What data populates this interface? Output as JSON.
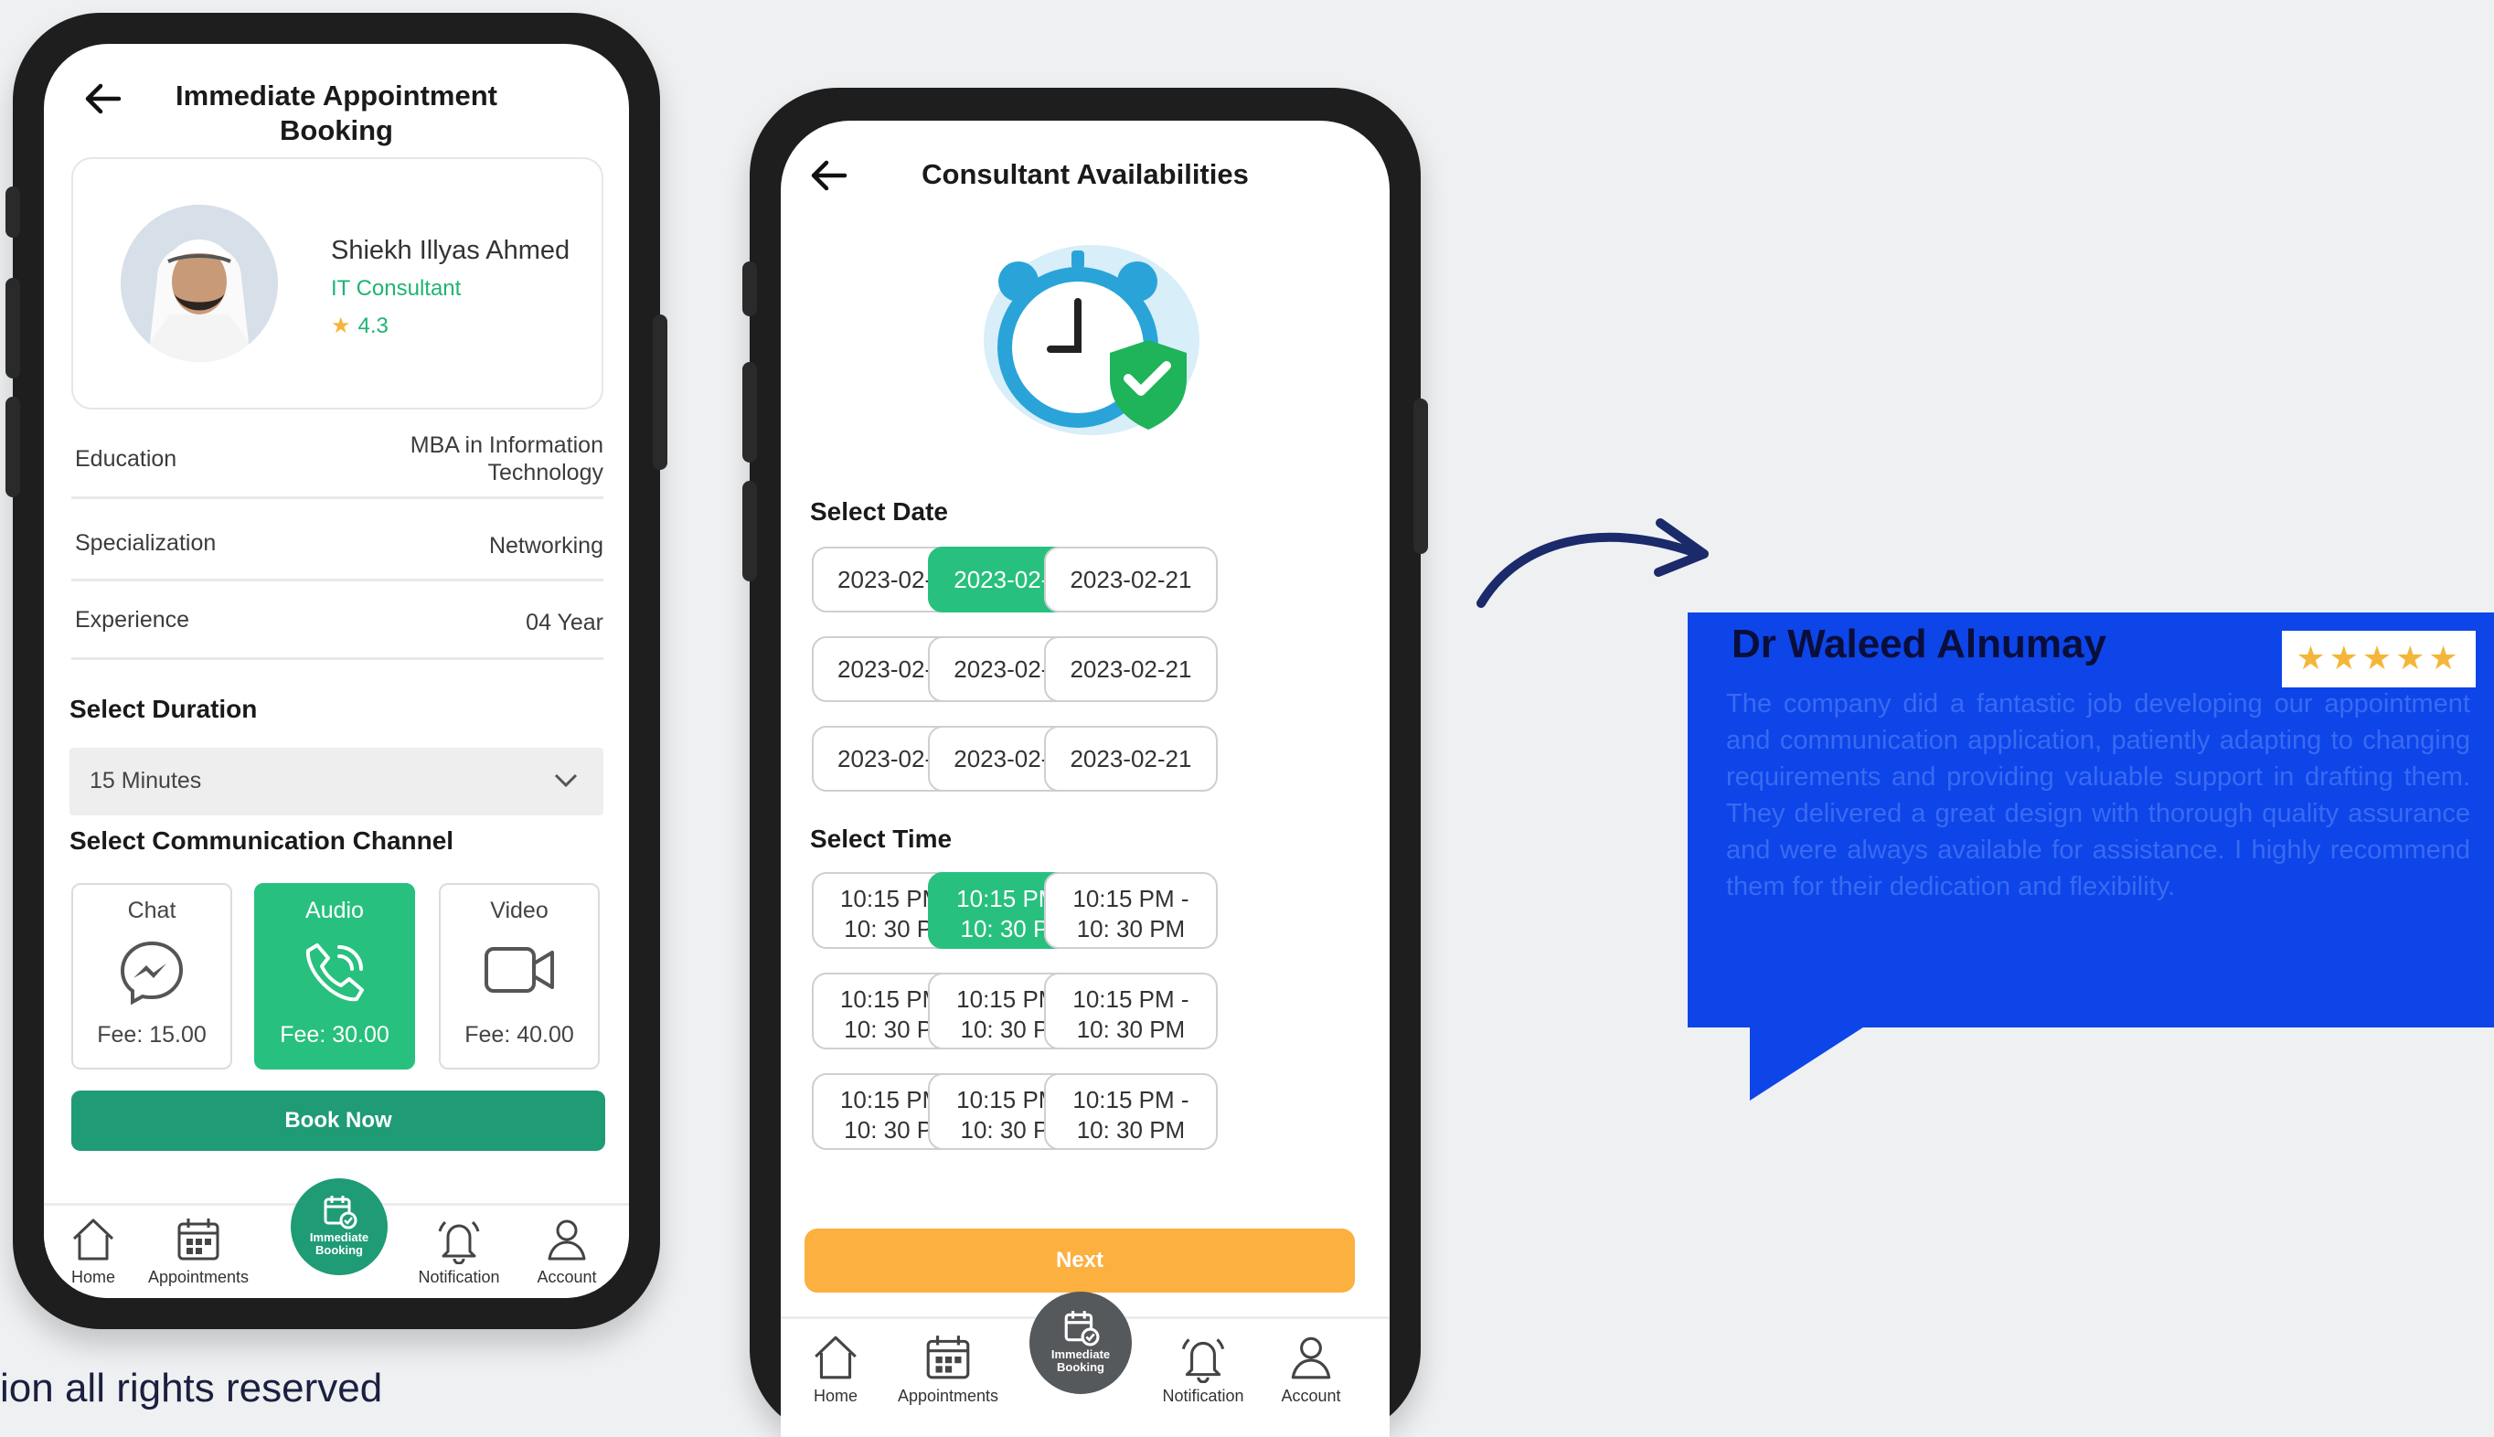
{
  "booking": {
    "title_line1": "Immediate Appointment",
    "title_line2": "Booking",
    "consultant": {
      "name": "Shiekh Illyas Ahmed",
      "role": "IT Consultant",
      "rating": "4.3"
    },
    "details": [
      {
        "label": "Education",
        "value_line1": "MBA in Information",
        "value_line2": "Technology"
      },
      {
        "label": "Specialization",
        "value_line1": "Networking",
        "value_line2": ""
      },
      {
        "label": "Experience",
        "value_line1": "04 Year",
        "value_line2": ""
      }
    ],
    "duration_heading": "Select Duration",
    "duration_value": "15 Minutes",
    "channel_heading": "Select Communication Channel",
    "channels": [
      {
        "label": "Chat",
        "fee": "Fee: 15.00",
        "icon": "messenger-icon"
      },
      {
        "label": "Audio",
        "fee": "Fee: 30.00",
        "icon": "phone-icon"
      },
      {
        "label": "Video",
        "fee": "Fee: 40.00",
        "icon": "video-camera-icon"
      }
    ],
    "selected_channel": "Audio",
    "book_label": "Book Now"
  },
  "availability": {
    "title": "Consultant Availabilities",
    "date_heading": "Select Date",
    "dates": [
      "2023-02-21",
      "2023-02-21",
      "2023-02-21",
      "2023-02-21",
      "2023-02-21",
      "2023-02-21",
      "2023-02-21",
      "2023-02-21",
      "2023-02-21"
    ],
    "selected_date_index": 1,
    "time_heading": "Select Time",
    "times": [
      {
        "line1": "10:15 PM -",
        "line2": "10: 30 PM"
      },
      {
        "line1": "10:15 PM -",
        "line2": "10: 30 PM"
      },
      {
        "line1": "10:15 PM -",
        "line2": "10: 30 PM"
      },
      {
        "line1": "10:15 PM -",
        "line2": "10: 30 PM"
      },
      {
        "line1": "10:15 PM -",
        "line2": "10: 30 PM"
      },
      {
        "line1": "10:15 PM -",
        "line2": "10: 30 PM"
      },
      {
        "line1": "10:15 PM -",
        "line2": "10: 30 PM"
      },
      {
        "line1": "10:15 PM -",
        "line2": "10: 30 PM"
      },
      {
        "line1": "10:15 PM -",
        "line2": "10: 30 PM"
      }
    ],
    "selected_time_index": 1,
    "next_label": "Next"
  },
  "nav": {
    "home": "Home",
    "appointments": "Appointments",
    "appointments_alt": "Appointments",
    "center_line1": "Immediate",
    "center_line2": "Booking",
    "notification": "Notification",
    "account": "Account"
  },
  "review": {
    "name": "Dr Waleed Alnumay",
    "stars": "★★★★★",
    "rating": 5,
    "text": "The company did a fantastic job developing our appointment and communication application, patiently adapting to changing requirements and providing valuable support in drafting them. They delivered a great design with thorough quality assurance and were always available for assistance. I highly recommend them for their dedication and flexibility."
  },
  "footer": {
    "text": "ion all rights reserved"
  },
  "colors": {
    "green": "#28c07e",
    "dark_green": "#1f9b76",
    "orange": "#fbb040",
    "review_blue": "#0d45e8",
    "nav_dark": "#55595c"
  }
}
